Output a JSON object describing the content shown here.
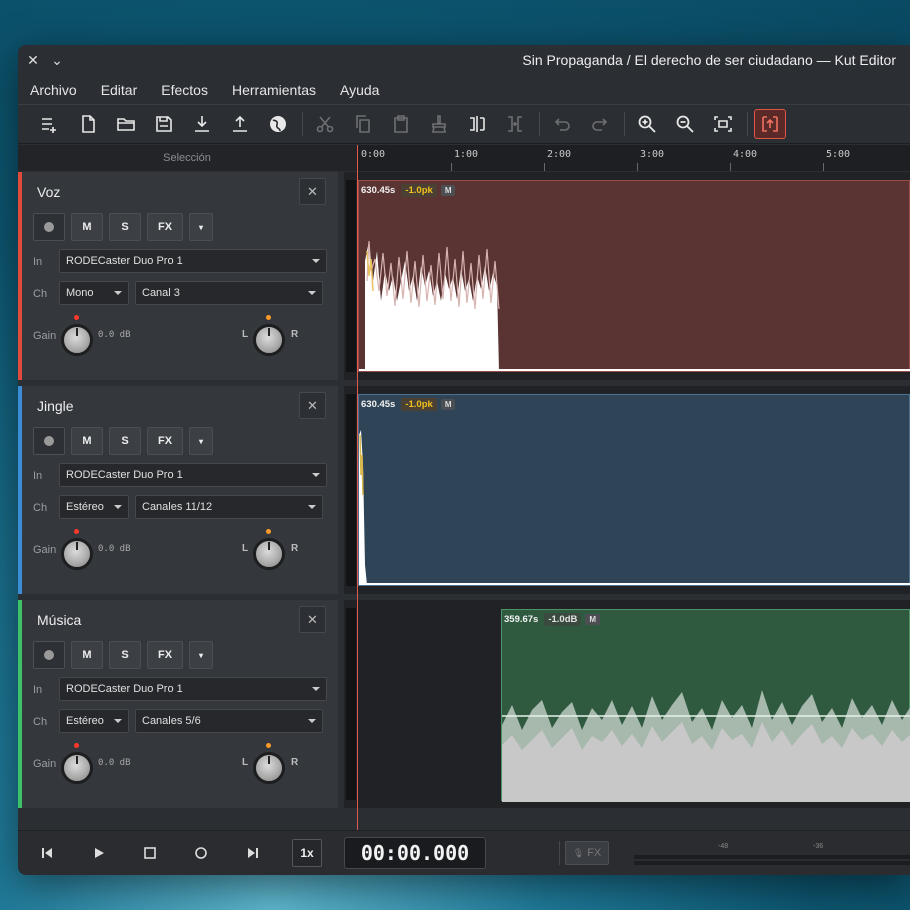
{
  "window": {
    "title": "Sin Propaganda / El derecho de ser ciudadano — Kut Editor",
    "close_glyph": "✕",
    "chevron_glyph": "⌄"
  },
  "menu": [
    "Archivo",
    "Editar",
    "Efectos",
    "Herramientas",
    "Ayuda"
  ],
  "toolbar": {
    "icons": [
      "add-track-icon",
      "new-file-icon",
      "open-folder-icon",
      "save-icon",
      "import-icon",
      "export-icon",
      "globe-icon",
      "cut-icon",
      "copy-icon",
      "paste-icon",
      "clean-icon",
      "split-icon",
      "join-icon",
      "undo-icon",
      "redo-icon",
      "zoom-in-icon",
      "zoom-out-icon",
      "fit-icon",
      "snap-icon"
    ],
    "active": "snap-icon"
  },
  "selection_label": "Selección",
  "ruler": {
    "ticks": [
      "0:00",
      "1:00",
      "2:00",
      "3:00",
      "4:00",
      "5:00"
    ]
  },
  "tracks": [
    {
      "name": "Voz",
      "color": "#e04b3c",
      "buttons": [
        "M",
        "S",
        "FX",
        "▾"
      ],
      "in_label": "In",
      "input": "RODECaster Duo Pro 1",
      "ch_label": "Ch",
      "channel_mode": "Mono",
      "channels": "Canal 3",
      "gain_label": "Gain",
      "gain_value": "0.0 dB",
      "pan_l": "L",
      "pan_r": "R",
      "clip": {
        "duration": "630.45s",
        "peak": "-1.0pk",
        "m": "M",
        "bg": "#5a3433",
        "border": "#9d4d48"
      }
    },
    {
      "name": "Jingle",
      "color": "#3b8ed6",
      "buttons": [
        "M",
        "S",
        "FX",
        "▾"
      ],
      "in_label": "In",
      "input": "RODECaster Duo Pro 1",
      "ch_label": "Ch",
      "channel_mode": "Estéreo",
      "channels": "Canales 11/12",
      "gain_label": "Gain",
      "gain_value": "0.0 dB",
      "pan_l": "L",
      "pan_r": "R",
      "clip": {
        "duration": "630.45s",
        "peak": "-1.0pk",
        "m": "M",
        "bg": "#2f4557",
        "border": "#4d7190"
      }
    },
    {
      "name": "Música",
      "color": "#3ec267",
      "buttons": [
        "M",
        "S",
        "FX",
        "▾"
      ],
      "in_label": "In",
      "input": "RODECaster Duo Pro 1",
      "ch_label": "Ch",
      "channel_mode": "Estéreo",
      "channels": "Canales 5/6",
      "gain_label": "Gain",
      "gain_value": "0.0 dB",
      "pan_l": "L",
      "pan_r": "R",
      "clip": {
        "duration": "359.67s",
        "peak": "-1.0dB",
        "m": "M",
        "bg": "#2f5a40",
        "border": "#4e9467"
      }
    }
  ],
  "transport": {
    "speed": "1x",
    "time": "00:00.000",
    "fx": "FX",
    "meter_labels": [
      "-48",
      "-36"
    ]
  }
}
